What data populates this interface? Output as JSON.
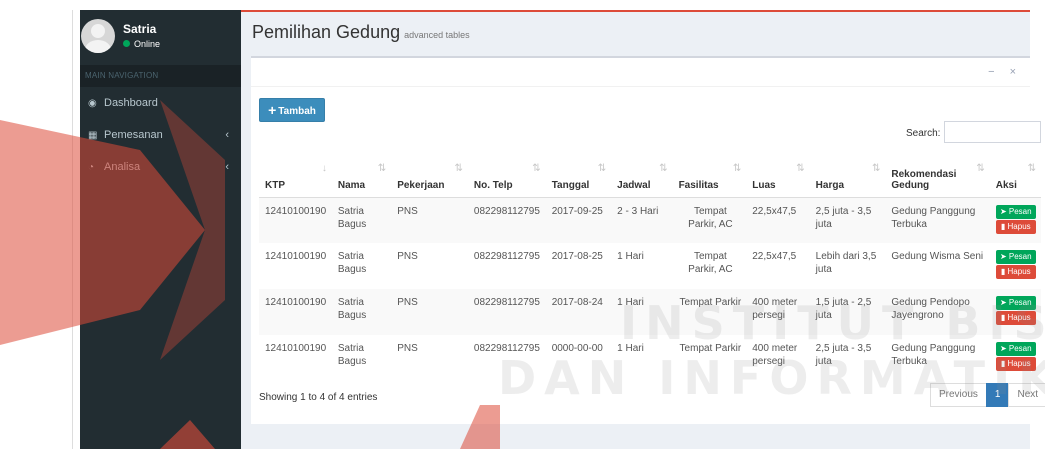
{
  "user": {
    "name": "Satria",
    "status": "Online"
  },
  "nav": {
    "header": "MAIN NAVIGATION",
    "items": [
      {
        "label": "Dashboard",
        "icon": "dashboard-icon",
        "glyph": "◉",
        "chevron": ""
      },
      {
        "label": "Pemesanan",
        "icon": "building-icon",
        "glyph": "▦",
        "chevron": "‹"
      },
      {
        "label": "Analisa",
        "icon": "pie-chart-icon",
        "glyph": "◔",
        "chevron": "‹"
      }
    ]
  },
  "header": {
    "title": "Pemilihan Gedung",
    "subtitle": "advanced tables"
  },
  "box": {
    "tools": "− ×"
  },
  "toolbar": {
    "tambah_label": "Tambah",
    "search_label": "Search:",
    "search_value": ""
  },
  "table": {
    "columns": [
      "KTP",
      "Nama",
      "Pekerjaan",
      "No. Telp",
      "Tanggal",
      "Jadwal",
      "Fasilitas",
      "Luas",
      "Harga",
      "Rekomendasi Gedung",
      "Aksi"
    ],
    "rows": [
      [
        "12410100190",
        "Satria Bagus",
        "PNS",
        "082298112795",
        "2017-09-25",
        "2 - 3 Hari",
        "Tempat Parkir, AC",
        "22,5x47,5",
        "2,5 juta - 3,5 juta",
        "Gedung Panggung Terbuka"
      ],
      [
        "12410100190",
        "Satria Bagus",
        "PNS",
        "082298112795",
        "2017-08-25",
        "1 Hari",
        "Tempat Parkir, AC",
        "22,5x47,5",
        "Lebih dari 3,5 juta",
        "Gedung Wisma Seni"
      ],
      [
        "12410100190",
        "Satria Bagus",
        "PNS",
        "082298112795",
        "2017-08-24",
        "1 Hari",
        "Tempat Parkir",
        "400 meter persegi",
        "1,5 juta - 2,5 juta",
        "Gedung Pendopo Jayengrono"
      ],
      [
        "12410100190",
        "Satria Bagus",
        "PNS",
        "082298112795",
        "0000-00-00",
        "1 Hari",
        "Tempat Parkir",
        "400 meter persegi",
        "2,5 juta - 3,5 juta",
        "Gedung Panggung Terbuka"
      ]
    ],
    "pesan_label": "Pesan",
    "hapus_label": "Hapus"
  },
  "footer": {
    "info": "Showing 1 to 4 of 4 entries",
    "previous": "Previous",
    "current_page": "1",
    "next": "Next"
  },
  "watermark": {
    "line1": "INSTITUT BISNIS",
    "line2": "DAN INFORMATIKA"
  },
  "colors": {
    "sidebar": "#222d32",
    "accent_red": "#dd4b39",
    "primary_blue": "#3c8dbc",
    "success_green": "#00a65a",
    "content_bg": "#ecf0f5"
  }
}
